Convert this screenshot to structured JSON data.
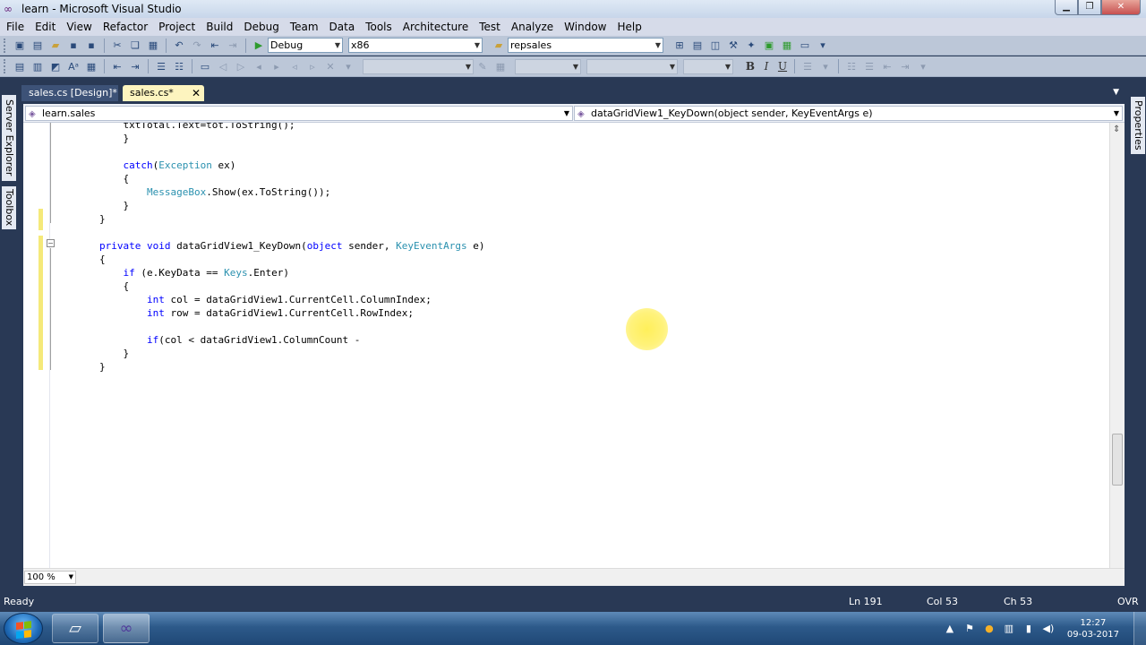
{
  "window": {
    "title": "learn - Microsoft Visual Studio"
  },
  "menu": [
    "File",
    "Edit",
    "View",
    "Refactor",
    "Project",
    "Build",
    "Debug",
    "Team",
    "Data",
    "Tools",
    "Architecture",
    "Test",
    "Analyze",
    "Window",
    "Help"
  ],
  "toolbar": {
    "config": "Debug",
    "platform": "x86",
    "find": "repsales"
  },
  "side_tabs": {
    "server_explorer": "Server Explorer",
    "toolbox": "Toolbox",
    "properties": "Properties"
  },
  "tabs": [
    {
      "label": "sales.cs [Design]*",
      "active": false
    },
    {
      "label": "sales.cs*",
      "active": true
    }
  ],
  "nav": {
    "type": "learn.sales",
    "member": "dataGridView1_KeyDown(object sender, KeyEventArgs e)"
  },
  "code_lines": [
    [
      {
        "t": "            txtTotal.Text=tot.ToString();"
      }
    ],
    [
      {
        "t": "            }"
      }
    ],
    [
      {
        "t": ""
      }
    ],
    [
      {
        "t": "            "
      },
      {
        "t": "catch",
        "c": "kw"
      },
      {
        "t": "("
      },
      {
        "t": "Exception",
        "c": "ty"
      },
      {
        "t": " ex)"
      }
    ],
    [
      {
        "t": "            {"
      }
    ],
    [
      {
        "t": "                "
      },
      {
        "t": "MessageBox",
        "c": "ty"
      },
      {
        "t": ".Show(ex.ToString());"
      }
    ],
    [
      {
        "t": "            }"
      }
    ],
    [
      {
        "t": "        }"
      }
    ],
    [
      {
        "t": ""
      }
    ],
    [
      {
        "t": "        "
      },
      {
        "t": "private",
        "c": "kw"
      },
      {
        "t": " "
      },
      {
        "t": "void",
        "c": "kw"
      },
      {
        "t": " dataGridView1_KeyDown("
      },
      {
        "t": "object",
        "c": "kw"
      },
      {
        "t": " sender, "
      },
      {
        "t": "KeyEventArgs",
        "c": "ty"
      },
      {
        "t": " e)"
      }
    ],
    [
      {
        "t": "        {"
      }
    ],
    [
      {
        "t": "            "
      },
      {
        "t": "if",
        "c": "kw"
      },
      {
        "t": " (e.KeyData == "
      },
      {
        "t": "Keys",
        "c": "ty"
      },
      {
        "t": ".Enter)"
      }
    ],
    [
      {
        "t": "            {"
      }
    ],
    [
      {
        "t": "                "
      },
      {
        "t": "int",
        "c": "kw"
      },
      {
        "t": " col = dataGridView1.CurrentCell.ColumnIndex;"
      }
    ],
    [
      {
        "t": "                "
      },
      {
        "t": "int",
        "c": "kw"
      },
      {
        "t": " row = dataGridView1.CurrentCell.RowIndex;"
      }
    ],
    [
      {
        "t": ""
      }
    ],
    [
      {
        "t": "                "
      },
      {
        "t": "if",
        "c": "kw"
      },
      {
        "t": "(col < dataGridView1.ColumnCount -"
      }
    ],
    [
      {
        "t": "            }"
      }
    ],
    [
      {
        "t": "        }"
      }
    ]
  ],
  "zoom": "100 %",
  "status": {
    "text": "Ready",
    "ln": "Ln 191",
    "col": "Col 53",
    "ch": "Ch 53",
    "mode": "OVR"
  },
  "clock": {
    "time": "12:27",
    "date": "09-03-2017"
  }
}
